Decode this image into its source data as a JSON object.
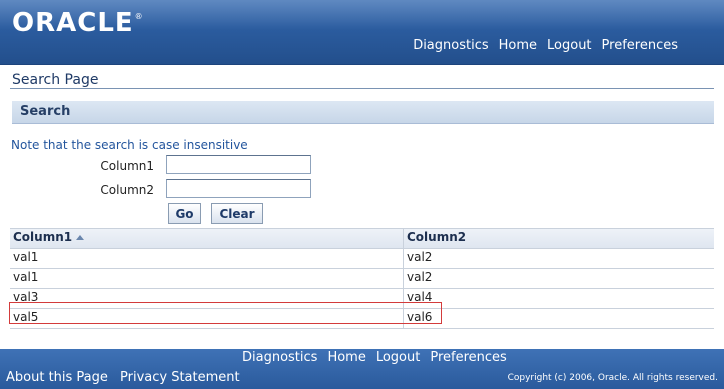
{
  "header": {
    "logo": "ORACLE",
    "logo_mark": "®",
    "nav": [
      "Diagnostics",
      "Home",
      "Logout",
      "Preferences"
    ]
  },
  "page": {
    "title": "Search Page"
  },
  "search": {
    "section_title": "Search",
    "note": "Note that the search is case insensitive",
    "field1_label": "Column1",
    "field1_value": "",
    "field2_label": "Column2",
    "field2_value": "",
    "go_label": "Go",
    "clear_label": "Clear"
  },
  "table": {
    "headers": [
      "Column1",
      "Column2"
    ],
    "rows": [
      [
        "val1",
        "val2"
      ],
      [
        "val1",
        "val2"
      ],
      [
        "val3",
        "val4"
      ],
      [
        "val5",
        "val6"
      ]
    ],
    "sorted_column": "Column1",
    "sort_direction": "ascending"
  },
  "footer": {
    "nav": [
      "Diagnostics",
      "Home",
      "Logout",
      "Preferences"
    ],
    "about": "About this Page",
    "privacy": "Privacy Statement",
    "copyright": "Copyright (c) 2006, Oracle. All rights reserved."
  },
  "colors": {
    "brand_blue": "#2b5c9f",
    "highlight_border": "#d33b3b"
  }
}
